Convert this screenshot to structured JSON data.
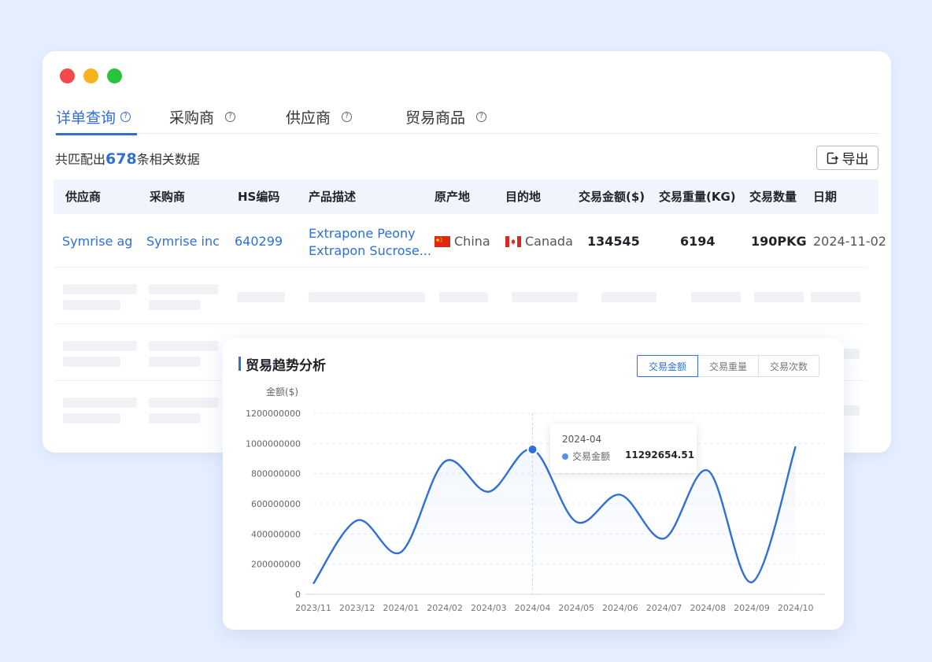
{
  "tabs": [
    {
      "label": "详单查询"
    },
    {
      "label": "采购商"
    },
    {
      "label": "供应商"
    },
    {
      "label": "贸易商品"
    }
  ],
  "summary": {
    "prefix": "共匹配出",
    "count": "678",
    "suffix": "条相关数据"
  },
  "export_label": "导出",
  "table": {
    "headers": [
      "供应商",
      "采购商",
      "HS编码",
      "产品描述",
      "原产地",
      "目的地",
      "交易金额($)",
      "交易重量(KG)",
      "交易数量",
      "日期"
    ],
    "row": {
      "supplier": "Symrise ag",
      "buyer": "Symrise inc",
      "hs_code": "640299",
      "desc_line1": "Extrapone Peony",
      "desc_line2": "Extrapon Sucrose...",
      "origin": "China",
      "destination": "Canada",
      "amount": "134545",
      "weight": "6194",
      "quantity": "190PKG",
      "date": "2024-11-02"
    }
  },
  "chart_card": {
    "title": "贸易趋势分析",
    "segments": [
      "交易金额",
      "交易重量",
      "交易次数"
    ],
    "tooltip": {
      "date": "2024-04",
      "label": "交易金额",
      "value": "11292654.51"
    }
  },
  "colors": {
    "accent": "#2f6fd6",
    "line": "#2f6fd6",
    "background": "#e6efff"
  },
  "chart_data": {
    "type": "line",
    "title": "贸易趋势分析",
    "ylabel": "金额($)",
    "xlabel": "",
    "ylim": [
      0,
      1200000000
    ],
    "yticks": [
      0,
      200000000,
      400000000,
      600000000,
      800000000,
      1000000000,
      1200000000
    ],
    "categories": [
      "2023/11",
      "2023/12",
      "2024/01",
      "2024/02",
      "2024/03",
      "2024/04",
      "2024/05",
      "2024/06",
      "2024/07",
      "2024/08",
      "2024/09",
      "2024/10"
    ],
    "series": [
      {
        "name": "交易金额",
        "values": [
          70000000,
          490000000,
          280000000,
          880000000,
          680000000,
          960000000,
          480000000,
          660000000,
          370000000,
          820000000,
          80000000,
          980000000
        ]
      }
    ],
    "highlight": {
      "category": "2024/04"
    },
    "grid": true
  }
}
